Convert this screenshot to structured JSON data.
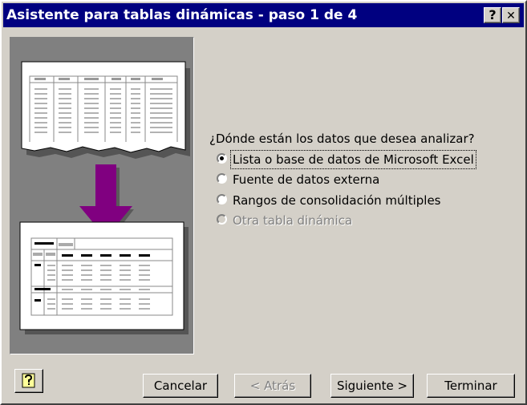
{
  "window": {
    "title": "Asistente para tablas dinámicas - paso 1 de 4",
    "help_glyph": "?",
    "close_glyph": "✕"
  },
  "question": "¿Dónde están los datos que desea analizar?",
  "options": [
    {
      "label": "Lista o base de datos de Microsoft Excel",
      "selected": true,
      "enabled": true
    },
    {
      "label": "Fuente de datos externa",
      "selected": false,
      "enabled": true
    },
    {
      "label": "Rangos de consolidación múltiples",
      "selected": false,
      "enabled": true
    },
    {
      "label": "Otra tabla dinámica",
      "selected": false,
      "enabled": false
    }
  ],
  "buttons": {
    "help_icon": "office-assistant-help-icon",
    "cancel": "Cancelar",
    "back": "< Atrás",
    "next": "Siguiente >",
    "finish": "Terminar"
  },
  "colors": {
    "titlebar": "#000080",
    "face": "#d4d0c8",
    "arrow": "#800080"
  }
}
